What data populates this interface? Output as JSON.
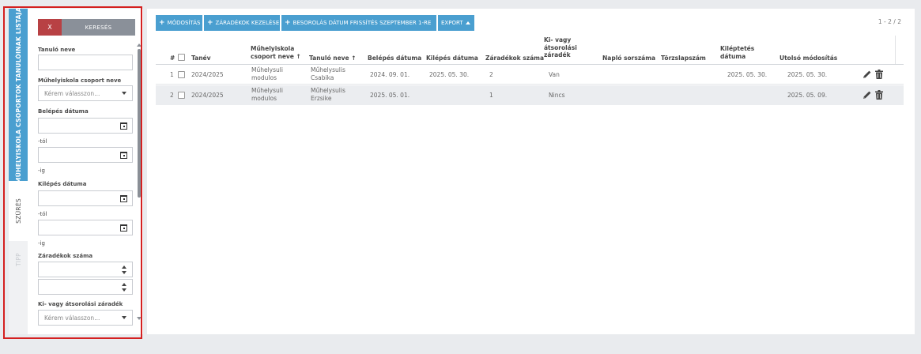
{
  "sidebar_tabs": {
    "list_tab": "MŰHELYISKOLA CSOPORTOK TANULÓINAK LISTÁJA",
    "filter_tab": "SZŰRÉS",
    "tip_tab": "TIPP"
  },
  "filter": {
    "clear_button": "X",
    "search_button": "KERESÉS",
    "student_name_label": "Tanuló neve",
    "student_name_value": "",
    "group_name_label": "Műhelyiskola csoport neve",
    "group_name_placeholder": "Kérem válasszon...",
    "entry_date_label": "Belépés dátuma",
    "from_suffix": "-tól",
    "to_suffix": "-ig",
    "exit_date_label": "Kilépés dátuma",
    "exit_from_suffix": "-tól",
    "exit_to_suffix": "-ig",
    "clause_count_label": "Záradékok száma",
    "clause_label": "Ki- vagy átsorolási záradék",
    "clause_placeholder": "Kérem válasszon..."
  },
  "toolbar": {
    "modify": "MÓDOSÍTÁS",
    "clauses": "ZÁRADÉKOK KEZELÉSE",
    "refresh": "BESOROLÁS DÁTUM FRISSÍTÉS SZEPTEMBER 1-RE",
    "export": "EXPORT"
  },
  "pager": "1 - 2 / 2",
  "table": {
    "headers": {
      "num": "#",
      "year": "Tanév",
      "group_l1": "Műhelyiskola",
      "group_l2": "csoport neve ↑",
      "student": "Tanuló neve ↑",
      "entry": "Belépés dátuma",
      "exit": "Kilépés dátuma",
      "clause_count": "Záradékok száma",
      "clause_l1": "Ki- vagy",
      "clause_l2": "átsorolási",
      "clause_l3": "záradék",
      "log": "Napló sorszáma",
      "register": "Törzslapszám",
      "leave_l1": "Kiléptetés",
      "leave_l2": "dátuma",
      "modified": "Utolsó módosítás"
    },
    "rows": [
      {
        "num": "1",
        "year": "2024/2025",
        "group_l1": "Műhelysuli",
        "group_l2": "modulos",
        "student_l1": "Műhelysulis",
        "student_l2": "Csabika",
        "entry": "2024. 09. 01.",
        "exit": "2025. 05. 30.",
        "clause_count": "2",
        "clause": "Van",
        "leave": "2025. 05. 30.",
        "modified": "2025. 05. 30."
      },
      {
        "num": "2",
        "year": "2024/2025",
        "group_l1": "Műhelysuli",
        "group_l2": "modulos",
        "student_l1": "Műhelysulis",
        "student_l2": "Erzsike",
        "entry": "2025. 05. 01.",
        "exit": "",
        "clause_count": "1",
        "clause": "Nincs",
        "leave": "",
        "modified": "2025. 05. 09."
      }
    ]
  },
  "colors": {
    "accent": "#4a9fd0",
    "danger": "#b84144",
    "muted_button": "#8a9099",
    "highlight": "#d42020"
  },
  "icons": [
    "calendar-icon",
    "pencil-icon",
    "trash-icon",
    "chevron-down-icon",
    "spinner-icon"
  ]
}
